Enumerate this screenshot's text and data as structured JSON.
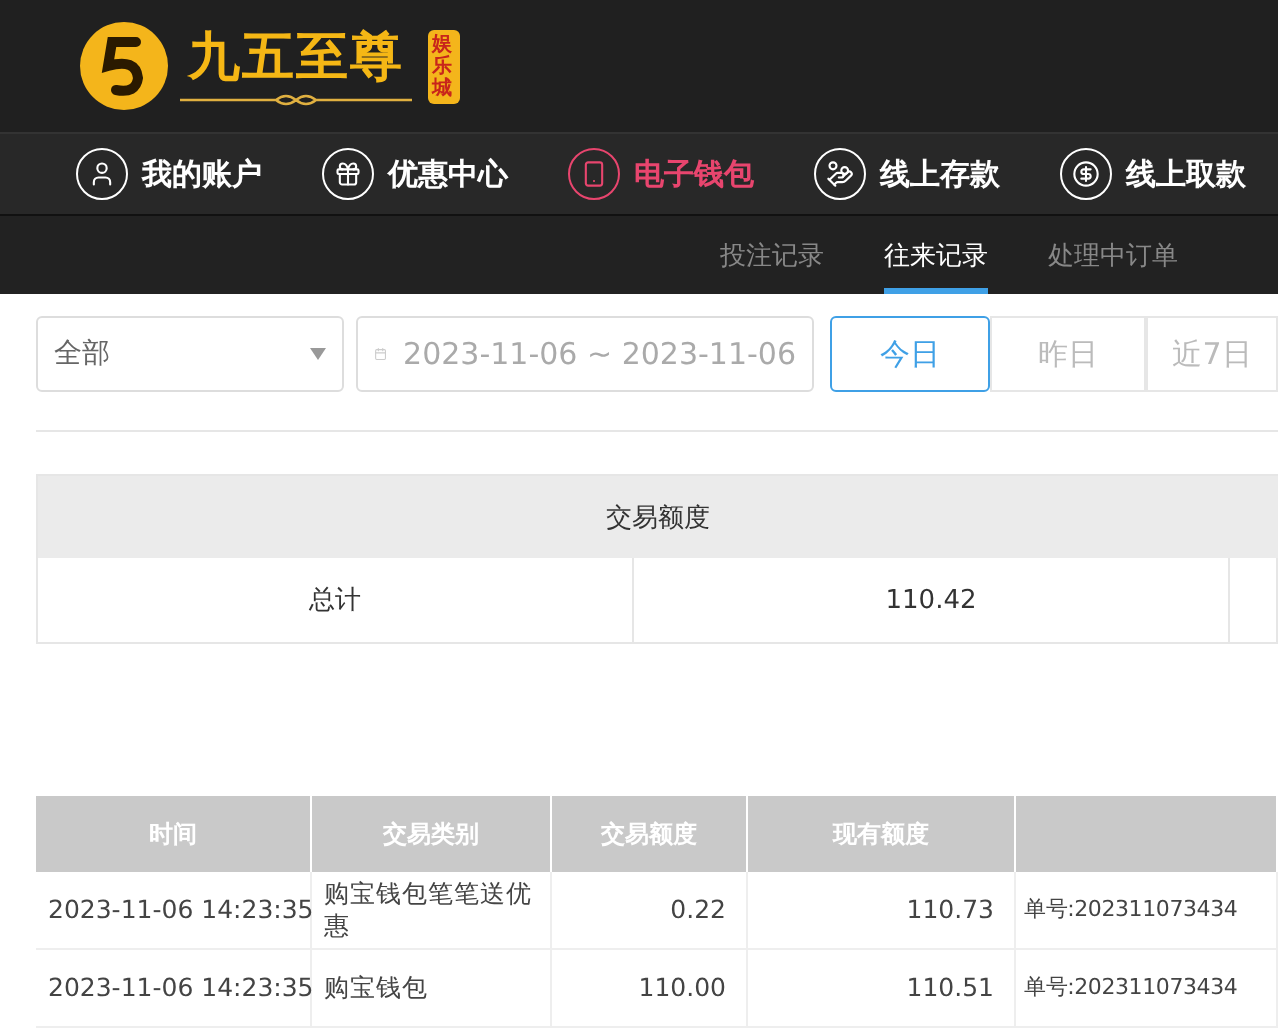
{
  "logo": {
    "name": "九五至尊",
    "badge": "娱乐城"
  },
  "nav": [
    {
      "label": "我的账户",
      "selected": false
    },
    {
      "label": "优惠中心",
      "selected": false
    },
    {
      "label": "电子钱包",
      "selected": true
    },
    {
      "label": "线上存款",
      "selected": false
    },
    {
      "label": "线上取款",
      "selected": false
    }
  ],
  "subnav": [
    {
      "label": "投注记录",
      "selected": false
    },
    {
      "label": "往来记录",
      "selected": true
    },
    {
      "label": "处理中订单",
      "selected": false
    }
  ],
  "filters": {
    "category": "全部",
    "date_range": "2023-11-06 ~ 2023-11-06",
    "quick_ranges": [
      {
        "label": "今日",
        "selected": true
      },
      {
        "label": "昨日",
        "selected": false
      },
      {
        "label": "近7日",
        "selected": false
      }
    ]
  },
  "summary": {
    "header": "交易额度",
    "row": {
      "label": "总计",
      "value": "110.42"
    }
  },
  "table": {
    "columns": [
      "时间",
      "交易类别",
      "交易额度",
      "现有额度"
    ],
    "rows": [
      {
        "time": "2023-11-06 14:23:35",
        "type": "购宝钱包笔笔送优惠",
        "amount": "0.22",
        "balance": "110.73",
        "remark": "单号:202311073434"
      },
      {
        "time": "2023-11-06 14:23:35",
        "type": "购宝钱包",
        "amount": "110.00",
        "balance": "110.51",
        "remark": "单号:202311073434"
      }
    ]
  }
}
